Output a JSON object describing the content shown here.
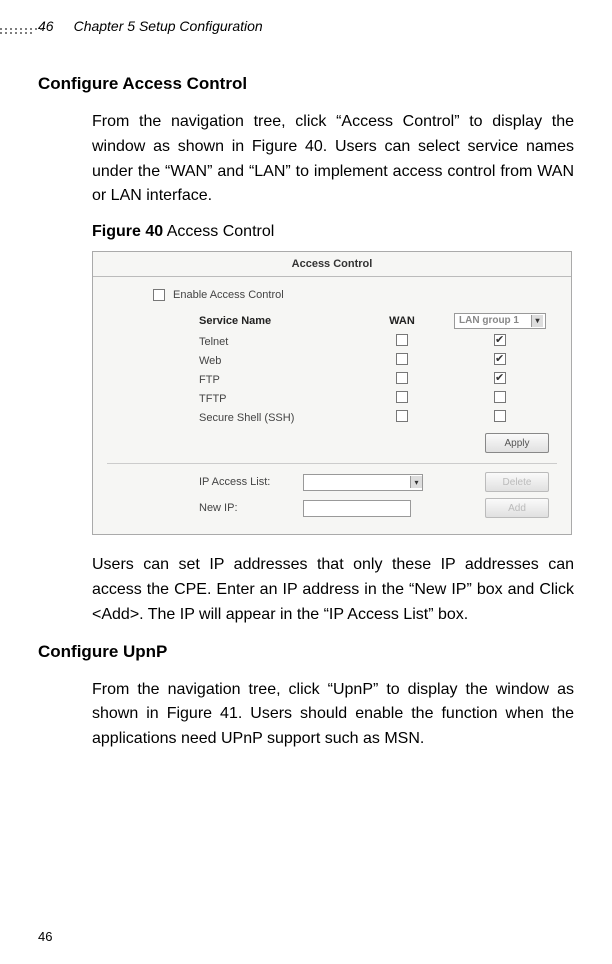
{
  "header": {
    "page_num_top": "46",
    "chapter": "Chapter 5 Setup Configuration"
  },
  "sections": {
    "access_control": {
      "heading": "Configure Access Control",
      "para1": "From the navigation tree, click “Access Control” to display the window as shown in Figure 40. Users can select service names under the “WAN” and “LAN” to implement access control from WAN or LAN interface.",
      "figure_caption_bold": "Figure 40",
      "figure_caption_rest": " Access Control",
      "para2": "Users can set IP addresses that only these IP addresses can access the CPE. Enter an IP address in the “New IP” box and Click <Add>. The IP will appear in the “IP Access List” box."
    },
    "upnp": {
      "heading": "Configure UpnP",
      "para1": "From the navigation tree, click “UpnP” to display the window as shown in Figure 41. Users should enable the function when the applications need UPnP support such as MSN."
    }
  },
  "figure": {
    "panel_title": "Access Control",
    "enable_label": "Enable Access Control",
    "enable_checked": false,
    "columns": {
      "name": "Service Name",
      "wan": "WAN",
      "lan_select": "LAN group 1"
    },
    "services": [
      {
        "name": "Telnet",
        "wan": false,
        "lan": true
      },
      {
        "name": "Web",
        "wan": false,
        "lan": true
      },
      {
        "name": "FTP",
        "wan": false,
        "lan": true
      },
      {
        "name": "TFTP",
        "wan": false,
        "lan": false
      },
      {
        "name": "Secure Shell (SSH)",
        "wan": false,
        "lan": false
      }
    ],
    "buttons": {
      "apply": "Apply",
      "delete": "Delete",
      "add": "Add"
    },
    "ip_list_label": "IP Access List:",
    "new_ip_label": "New IP:"
  },
  "footer": {
    "page_num_bottom": "46"
  }
}
